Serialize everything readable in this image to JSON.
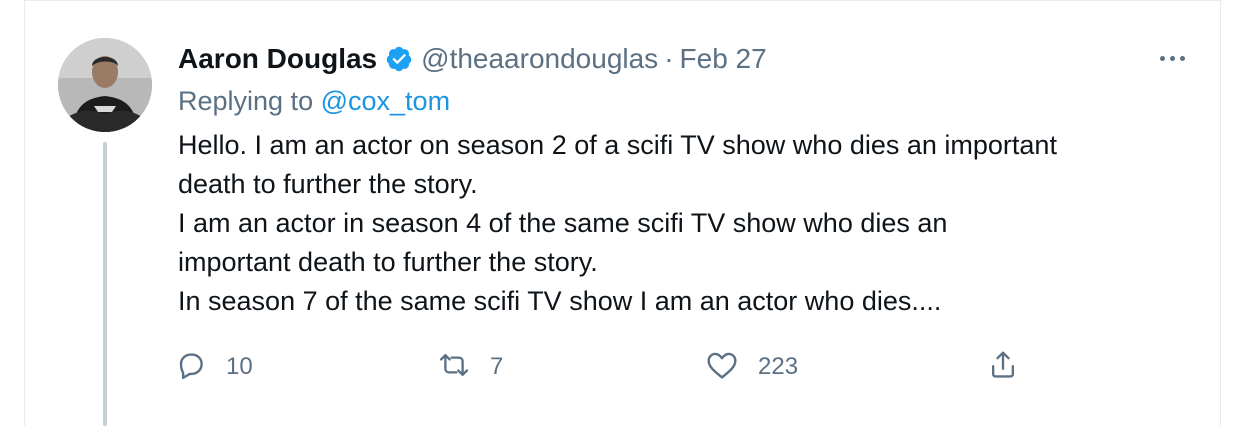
{
  "tweet": {
    "author": {
      "name": "Aaron Douglas",
      "handle": "@theaarondouglas",
      "verified": true
    },
    "date": "Feb 27",
    "separator": "·",
    "replying_prefix": "Replying to",
    "replying_to": "@cox_tom",
    "text_lines": [
      "Hello. I am an actor on season 2 of a scifi TV show who dies an important",
      "death to further the story.",
      "I am an actor in season 4 of the same scifi TV show who dies an",
      "important death to further the story.",
      "In season 7 of the same scifi TV show I am an actor who dies...."
    ],
    "stats": {
      "replies": "10",
      "retweets": "7",
      "likes": "223"
    }
  },
  "icons": {
    "verified": "verified-badge-icon",
    "more": "more-options-icon",
    "reply": "reply-icon",
    "retweet": "retweet-icon",
    "like": "heart-icon",
    "share": "share-icon"
  },
  "colors": {
    "text_primary": "#0f1419",
    "text_secondary": "#5b7083",
    "link": "#1b95e0",
    "verified": "#1da1f2",
    "thread_line": "#c4cfd6"
  }
}
